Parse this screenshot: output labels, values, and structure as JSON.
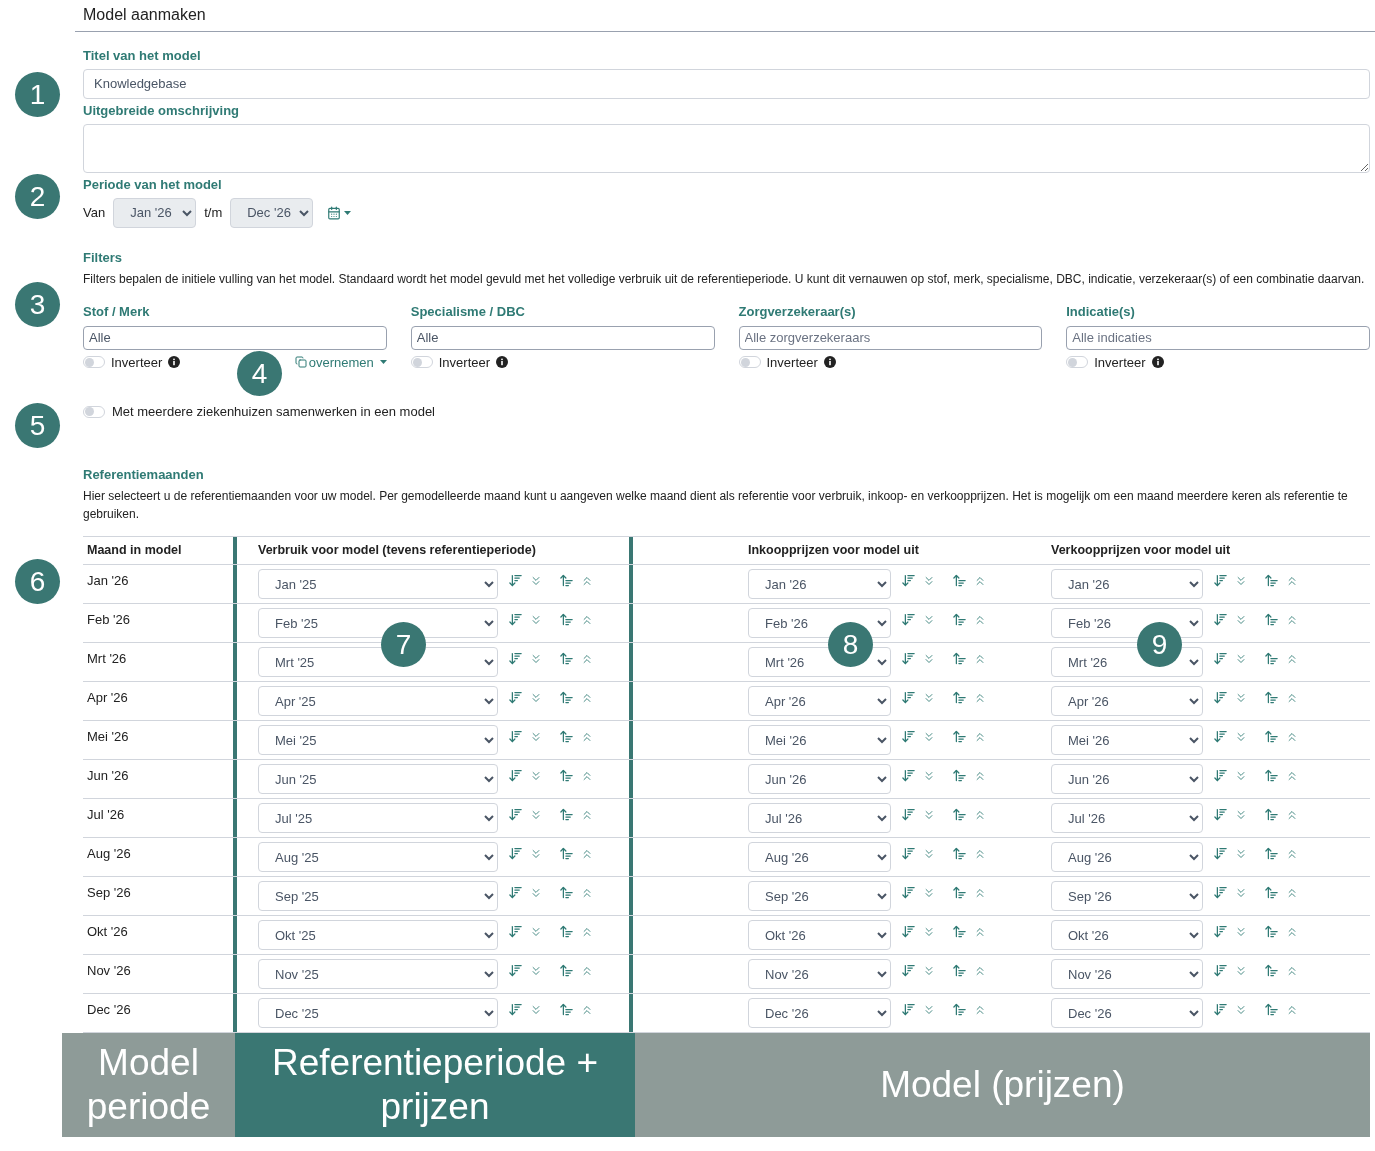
{
  "title": "Model aanmaken",
  "model_title": {
    "label": "Titel van het model",
    "value": "Knowledgebase"
  },
  "description": {
    "label": "Uitgebreide omschrijving"
  },
  "period": {
    "label": "Periode van het model",
    "from_label": "Van",
    "from": "Jan '26",
    "to_label": "t/m",
    "to": "Dec '26",
    "disabled": true
  },
  "filters": {
    "heading": "Filters",
    "text": "Filters bepalen de initiele vulling van het model. Standaard wordt het model gevuld met het volledige verbruik uit de referentieperiode. U kunt dit vernauwen op stof, merk, specialisme, DBC, indicatie, verzekeraar(s) of een combinatie daarvan.",
    "items": [
      {
        "label": "Stof / Merk",
        "value": "Alle",
        "invert_label": "Inverteer",
        "invert_on": false,
        "copy_link": "overnemen"
      },
      {
        "label": "Specialisme / DBC",
        "value": "Alle",
        "invert_label": "Inverteer",
        "invert_on": false
      },
      {
        "label": "Zorgverzekeraar(s)",
        "placeholder": "Alle zorgverzekeraars",
        "invert_label": "Inverteer",
        "invert_on": false
      },
      {
        "label": "Indicatie(s)",
        "placeholder": "Alle indicaties",
        "invert_label": "Inverteer",
        "invert_on": false
      }
    ]
  },
  "collaborate": {
    "label": "Met meerdere ziekenhuizen samenwerken in een model",
    "on": false
  },
  "reference": {
    "heading": "Referentiemaanden",
    "text": "Hier selecteert u de referentiemaanden voor uw model. Per gemodelleerde maand kunt u aangeven welke maand dient als referentie voor verbruik, inkoop- en verkoopprijzen. Het is mogelijk om een maand meerdere keren als referentie te gebruiken.",
    "columns": [
      "Maand in model",
      "Verbruik voor model (tevens referentieperiode)",
      "Inkoopprijzen voor model uit",
      "Verkoopprijzen voor model uit"
    ],
    "rows": [
      {
        "month": "Jan '26",
        "usage": "Jan '25",
        "purchase": "Jan '26",
        "sale": "Jan '26"
      },
      {
        "month": "Feb '26",
        "usage": "Feb '25",
        "purchase": "Feb '26",
        "sale": "Feb '26"
      },
      {
        "month": "Mrt '26",
        "usage": "Mrt '25",
        "purchase": "Mrt '26",
        "sale": "Mrt '26"
      },
      {
        "month": "Apr '26",
        "usage": "Apr '25",
        "purchase": "Apr '26",
        "sale": "Apr '26"
      },
      {
        "month": "Mei '26",
        "usage": "Mei '25",
        "purchase": "Mei '26",
        "sale": "Mei '26"
      },
      {
        "month": "Jun '26",
        "usage": "Jun '25",
        "purchase": "Jun '26",
        "sale": "Jun '26"
      },
      {
        "month": "Jul '26",
        "usage": "Jul '25",
        "purchase": "Jul '26",
        "sale": "Jul '26"
      },
      {
        "month": "Aug '26",
        "usage": "Aug '25",
        "purchase": "Aug '26",
        "sale": "Aug '26"
      },
      {
        "month": "Sep '26",
        "usage": "Sep '25",
        "purchase": "Sep '26",
        "sale": "Sep '26"
      },
      {
        "month": "Okt '26",
        "usage": "Okt '25",
        "purchase": "Okt '26",
        "sale": "Okt '26"
      },
      {
        "month": "Nov '26",
        "usage": "Nov '25",
        "purchase": "Nov '26",
        "sale": "Nov '26"
      },
      {
        "month": "Dec '26",
        "usage": "Dec '25",
        "purchase": "Dec '26",
        "sale": "Dec '26"
      }
    ]
  },
  "legend": [
    {
      "text": "Model periode",
      "color": "#8e9b98"
    },
    {
      "text": "Referentieperiode + prijzen",
      "color": "#3a7773"
    },
    {
      "text": "Model (prijzen)",
      "color": "#8e9b98"
    }
  ],
  "callouts": [
    "1",
    "2",
    "3",
    "4",
    "5",
    "6",
    "7",
    "8",
    "9"
  ]
}
